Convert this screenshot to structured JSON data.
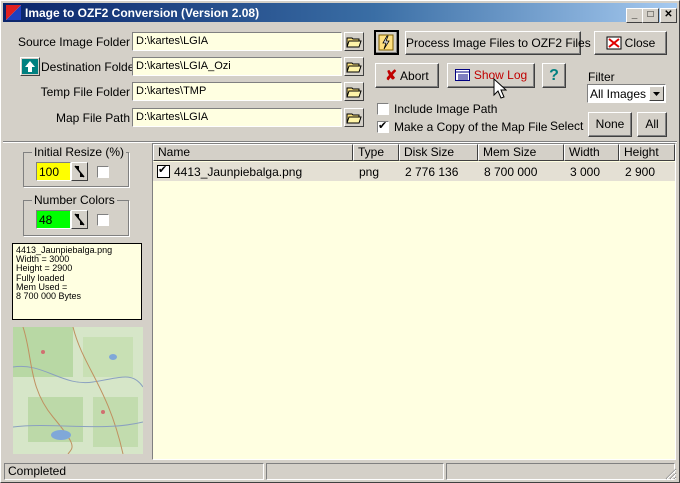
{
  "window": {
    "title": "Image to OZF2 Conversion (Version 2.08)",
    "minimize": "_",
    "maximize": "□",
    "close": "✕"
  },
  "folders": {
    "source_label": "Source Image Folder",
    "source_value": "D:\\kartes\\LGIA",
    "dest_label": "Destination Folder",
    "dest_value": "D:\\kartes\\LGIA_Ozi",
    "temp_label": "Temp File Folder",
    "temp_value": "D:\\kartes\\TMP",
    "map_label": "Map File Path",
    "map_value": "D:\\kartes\\LGIA"
  },
  "buttons": {
    "process": "Process Image Files to OZF2 Files",
    "close": "Close",
    "abort": "Abort",
    "show_log": "Show Log",
    "help": "?",
    "none": "None",
    "all": "All"
  },
  "filter": {
    "label": "Filter",
    "selected": "All Images"
  },
  "select_label": "Select",
  "options": {
    "include_path": "Include Image Path",
    "include_path_checked": false,
    "copy_map": "Make a Copy of the Map File",
    "copy_map_checked": true
  },
  "resize": {
    "title": "Initial Resize (%)",
    "value": "100",
    "color": "#ffff00"
  },
  "colors": {
    "title": "Number Colors",
    "value": "48",
    "color": "#00ff00"
  },
  "info": {
    "line1": "4413_Jaunpiebalga.png",
    "line2": "Width = 3000",
    "line3": "Height = 2900",
    "line4": "Fully loaded",
    "line5": "Mem Used =",
    "line6": "8 700 000 Bytes"
  },
  "table": {
    "headers": [
      "Name",
      "Type",
      "Disk Size",
      "Mem Size",
      "Width",
      "Height"
    ],
    "rows": [
      {
        "name": "4413_Jaunpiebalga.png",
        "type": "png",
        "disk": "2 776 136",
        "mem": "8 700 000",
        "width": "3 000",
        "height": "2 900",
        "checked": true
      }
    ]
  },
  "status": {
    "text": "Completed"
  }
}
